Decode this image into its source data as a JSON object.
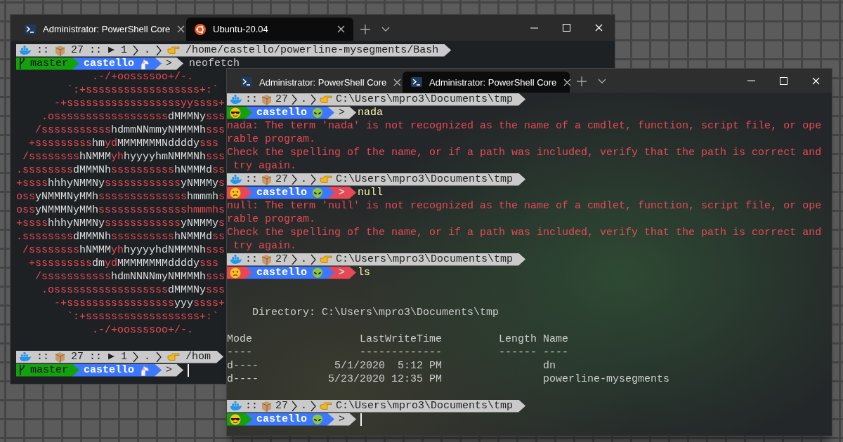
{
  "windows": [
    {
      "tabs": [
        {
          "title": "Administrator: PowerShell Core",
          "kind": "powershell",
          "selected": false
        },
        {
          "title": "Ubuntu-20.04",
          "kind": "ubuntu",
          "selected": true
        }
      ],
      "lines": [
        {
          "kind": "path_prompt",
          "sep": "::",
          "count": "27",
          "jobs": ":: ▶ 1",
          "dir": ".",
          "path": "/home/castello/powerline-mysegments/Bash"
        },
        {
          "kind": "bash_prompt",
          "branch": "master",
          "user": "castello",
          "symbol": ">",
          "command": "neofetch"
        },
        {
          "kind": "ascii",
          "segments": [
            {
              "text": "            .-/+oossssoo+/-.",
              "color": "#e74856"
            }
          ]
        },
        {
          "kind": "ascii",
          "segments": [
            {
              "text": "        `:+ssssssssssssssssss+:`",
              "color": "#e74856"
            }
          ]
        },
        {
          "kind": "ascii",
          "segments": [
            {
              "text": "      -+ssssssssssssssssssyyssss+",
              "color": "#e74856"
            }
          ]
        },
        {
          "kind": "ascii",
          "segments": [
            {
              "text": "    .ossssssssssssssssss",
              "color": "#e74856"
            },
            {
              "text": "dMMMNy",
              "color": "#dcdcdc"
            },
            {
              "text": "sss",
              "color": "#e74856"
            }
          ]
        },
        {
          "kind": "ascii",
          "segments": [
            {
              "text": "   /sssssssssss",
              "color": "#e74856"
            },
            {
              "text": "hdmmNNmmyNMMMMh",
              "color": "#dcdcdc"
            },
            {
              "text": "sss",
              "color": "#e74856"
            }
          ]
        },
        {
          "kind": "ascii",
          "segments": [
            {
              "text": "  +sssssssss",
              "color": "#e74856"
            },
            {
              "text": "hm",
              "color": "#dcdcdc"
            },
            {
              "text": "yd",
              "color": "#e74856"
            },
            {
              "text": "MMMMMMMNddddy",
              "color": "#dcdcdc"
            },
            {
              "text": "sss",
              "color": "#e74856"
            }
          ]
        },
        {
          "kind": "ascii",
          "segments": [
            {
              "text": " /ssssssss",
              "color": "#e74856"
            },
            {
              "text": "hNMMM",
              "color": "#dcdcdc"
            },
            {
              "text": "yh",
              "color": "#e74856"
            },
            {
              "text": "hyyyyhmNMMMNh",
              "color": "#dcdcdc"
            },
            {
              "text": "sss",
              "color": "#e74856"
            }
          ]
        },
        {
          "kind": "ascii",
          "segments": [
            {
              "text": ".ssssssss",
              "color": "#e74856"
            },
            {
              "text": "dMMMNh",
              "color": "#dcdcdc"
            },
            {
              "text": "ssssssssss",
              "color": "#e74856"
            },
            {
              "text": "hNMMMd",
              "color": "#dcdcdc"
            },
            {
              "text": "ss",
              "color": "#e74856"
            }
          ]
        },
        {
          "kind": "ascii",
          "segments": [
            {
              "text": "+ssss",
              "color": "#e74856"
            },
            {
              "text": "hhhyNMMNy",
              "color": "#dcdcdc"
            },
            {
              "text": "ssssssssssss",
              "color": "#e74856"
            },
            {
              "text": "yNMMMy",
              "color": "#dcdcdc"
            },
            {
              "text": "s",
              "color": "#e74856"
            }
          ]
        },
        {
          "kind": "ascii",
          "segments": [
            {
              "text": "oss",
              "color": "#e74856"
            },
            {
              "text": "yNMMMNyMMh",
              "color": "#dcdcdc"
            },
            {
              "text": "ssssssssssssss",
              "color": "#e74856"
            },
            {
              "text": "hmmmh",
              "color": "#dcdcdc"
            },
            {
              "text": "s",
              "color": "#e74856"
            }
          ]
        },
        {
          "kind": "ascii",
          "segments": [
            {
              "text": "oss",
              "color": "#e74856"
            },
            {
              "text": "yNMMMNyMMh",
              "color": "#dcdcdc"
            },
            {
              "text": "sssssssssssssshmmmhs",
              "color": "#e74856"
            }
          ]
        },
        {
          "kind": "ascii",
          "segments": [
            {
              "text": "+ssss",
              "color": "#e74856"
            },
            {
              "text": "hhhyNMMNy",
              "color": "#dcdcdc"
            },
            {
              "text": "ssssssssssss",
              "color": "#e74856"
            },
            {
              "text": "yNMMMy",
              "color": "#dcdcdc"
            },
            {
              "text": "s",
              "color": "#e74856"
            }
          ]
        },
        {
          "kind": "ascii",
          "segments": [
            {
              "text": ".ssssssss",
              "color": "#e74856"
            },
            {
              "text": "dMMMNh",
              "color": "#dcdcdc"
            },
            {
              "text": "ssssssssss",
              "color": "#e74856"
            },
            {
              "text": "hNMMMd",
              "color": "#dcdcdc"
            },
            {
              "text": "ss",
              "color": "#e74856"
            }
          ]
        },
        {
          "kind": "ascii",
          "segments": [
            {
              "text": " /ssssssss",
              "color": "#e74856"
            },
            {
              "text": "hNMMM",
              "color": "#dcdcdc"
            },
            {
              "text": "yh",
              "color": "#e74856"
            },
            {
              "text": "hyyyyhdNMMMNh",
              "color": "#dcdcdc"
            },
            {
              "text": "sss",
              "color": "#e74856"
            }
          ]
        },
        {
          "kind": "ascii",
          "segments": [
            {
              "text": "  +sssssssss",
              "color": "#e74856"
            },
            {
              "text": "dm",
              "color": "#dcdcdc"
            },
            {
              "text": "yd",
              "color": "#e74856"
            },
            {
              "text": "MMMMMMMMddddy",
              "color": "#dcdcdc"
            },
            {
              "text": "sss",
              "color": "#e74856"
            }
          ]
        },
        {
          "kind": "ascii",
          "segments": [
            {
              "text": "   /sssssssssss",
              "color": "#e74856"
            },
            {
              "text": "hdmNNNNmyNMMMMh",
              "color": "#dcdcdc"
            },
            {
              "text": "sss",
              "color": "#e74856"
            }
          ]
        },
        {
          "kind": "ascii",
          "segments": [
            {
              "text": "    .ossssssssssssssssss",
              "color": "#e74856"
            },
            {
              "text": "dMMMNy",
              "color": "#dcdcdc"
            },
            {
              "text": "sss",
              "color": "#e74856"
            }
          ]
        },
        {
          "kind": "ascii",
          "segments": [
            {
              "text": "      -+sssssssssssssssss",
              "color": "#e74856"
            },
            {
              "text": "yyy",
              "color": "#dcdcdc"
            },
            {
              "text": "ssss+",
              "color": "#e74856"
            }
          ]
        },
        {
          "kind": "ascii",
          "segments": [
            {
              "text": "        `:+ssssssssssssssssss+:`",
              "color": "#e74856"
            }
          ]
        },
        {
          "kind": "ascii",
          "segments": [
            {
              "text": "            .-/+oossssoo+/-.",
              "color": "#e74856"
            }
          ]
        },
        {
          "kind": "blank"
        },
        {
          "kind": "path_prompt",
          "sep": "::",
          "count": "27",
          "jobs": ":: ▶ 1",
          "dir": ".",
          "path": "/hom"
        },
        {
          "kind": "bash_prompt",
          "branch": "master",
          "user": "castello",
          "symbol": ">",
          "cursor": true
        }
      ]
    },
    {
      "tabs": [
        {
          "title": "Administrator: PowerShell Core",
          "kind": "powershell",
          "selected": false
        },
        {
          "title": "Administrator: PowerShell Core",
          "kind": "powershell",
          "selected": true
        }
      ],
      "lines": [
        {
          "kind": "path_prompt",
          "sep": "::",
          "count": "27",
          "dir": ".",
          "path": "C:\\Users\\mpro3\\Documents\\tmp"
        },
        {
          "kind": "pwsh_prompt",
          "user": "castello",
          "symbol": ">",
          "last_failed": false,
          "command": "nada"
        },
        {
          "kind": "error",
          "text": "nada: The term 'nada' is not recognized as the name of a cmdlet, function, script file, or ope"
        },
        {
          "kind": "error",
          "text": "rable program."
        },
        {
          "kind": "error",
          "text": "Check the spelling of the name, or if a path was included, verify that the path is correct and"
        },
        {
          "kind": "error",
          "text": " try again."
        },
        {
          "kind": "path_prompt",
          "sep": "::",
          "count": "27",
          "dir": ".",
          "path": "C:\\Users\\mpro3\\Documents\\tmp"
        },
        {
          "kind": "pwsh_prompt",
          "user": "castello",
          "symbol": ">",
          "last_failed": true,
          "command": "null"
        },
        {
          "kind": "error",
          "text": "null: The term 'null' is not recognized as the name of a cmdlet, function, script file, or ope"
        },
        {
          "kind": "error",
          "text": "rable program."
        },
        {
          "kind": "error",
          "text": "Check the spelling of the name, or if a path was included, verify that the path is correct and"
        },
        {
          "kind": "error",
          "text": " try again."
        },
        {
          "kind": "path_prompt",
          "sep": "::",
          "count": "27",
          "dir": ".",
          "path": "C:\\Users\\mpro3\\Documents\\tmp"
        },
        {
          "kind": "pwsh_prompt",
          "user": "castello",
          "symbol": ">",
          "last_failed": true,
          "command": "ls"
        },
        {
          "kind": "blank"
        },
        {
          "kind": "blank"
        },
        {
          "kind": "output",
          "text": "    Directory: C:\\Users\\mpro3\\Documents\\tmp"
        },
        {
          "kind": "blank"
        },
        {
          "kind": "output",
          "text": "Mode                 LastWriteTime         Length Name"
        },
        {
          "kind": "output",
          "text": "----                 -------------         ------ ----"
        },
        {
          "kind": "output",
          "text": "d----            5/1/2020  5:12 PM                dn"
        },
        {
          "kind": "output",
          "text": "d----           5/23/2020 12:35 PM                powerline-mysegments"
        },
        {
          "kind": "blank"
        },
        {
          "kind": "path_prompt",
          "sep": "::",
          "count": "27",
          "dir": ".",
          "path": "C:\\Users\\mpro3\\Documents\\tmp"
        },
        {
          "kind": "pwsh_prompt",
          "user": "castello",
          "symbol": ">",
          "last_failed": false,
          "cursor": true
        }
      ]
    }
  ]
}
